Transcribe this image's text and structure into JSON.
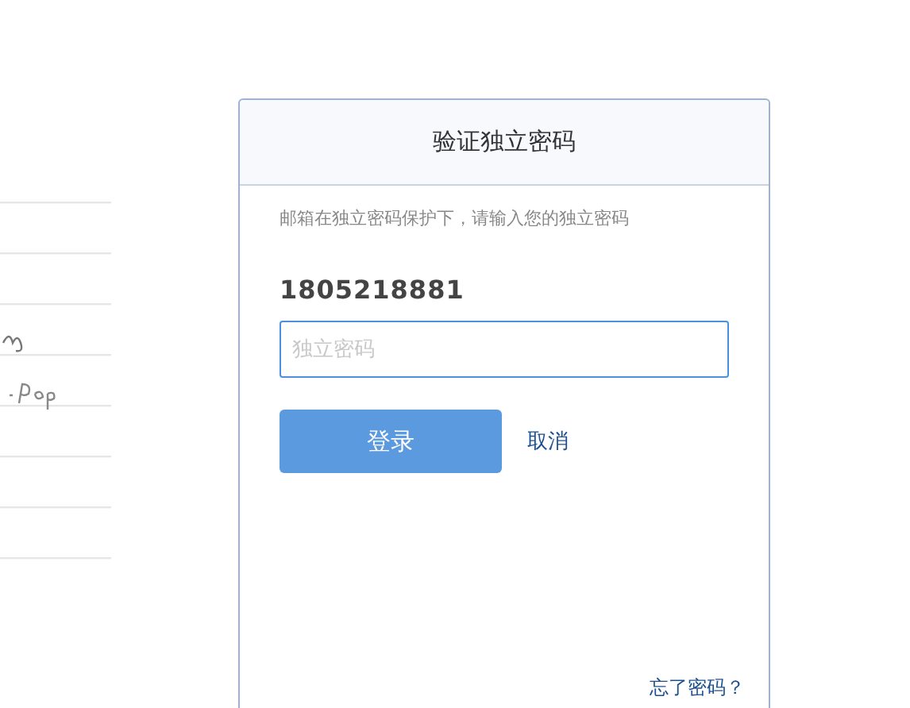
{
  "dialog": {
    "title": "验证独立密码",
    "hint": "邮箱在独立密码保护下，请输入您的独立密码",
    "account": "1805218881",
    "password_field": {
      "placeholder": "独立密码"
    },
    "login_button": "登录",
    "cancel_link": "取消",
    "forgot_link": "忘了密码？"
  }
}
